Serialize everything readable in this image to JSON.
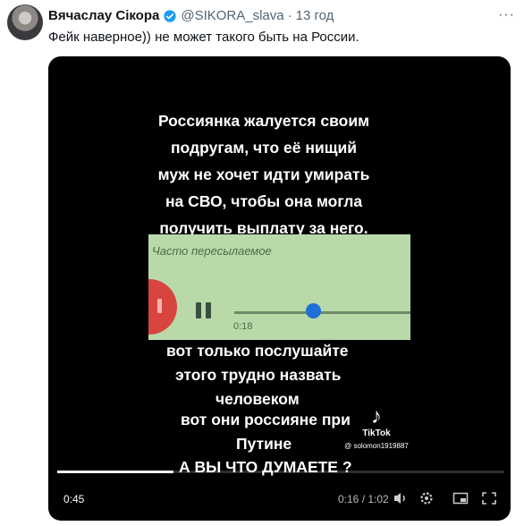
{
  "tweet": {
    "author_name": "Вячаслау Сікора",
    "handle": "@SIKORA_slava",
    "separator": "·",
    "time": "13 год",
    "more_label": "···",
    "text": "Фейк наверное)) не может такого быть на России."
  },
  "video": {
    "caption_top": [
      "Россиянка жалуется своим",
      "подругам, что её нищий",
      "муж не хочет идти умирать",
      "на СВО, чтобы она могла",
      "получить выплату за него."
    ],
    "audio_panel_label": "Часто пересылаемое",
    "audio_time": "0:18",
    "caption_line6": "вот только послушайте",
    "caption_line7": "этого трудно назвать",
    "caption_line8": "человеком",
    "caption_line9": "вот они россияне при",
    "caption_line10": "Путине",
    "caption_line11": "А ВЫ ЧТО ДУМАЕТЕ ?",
    "watermark_logo": "♪",
    "watermark_brand": "TikTok",
    "watermark_user": "@ solomon1919887",
    "elapsed": "0:45",
    "player_time": "0:16 / 1:02",
    "progress": 0.26
  }
}
